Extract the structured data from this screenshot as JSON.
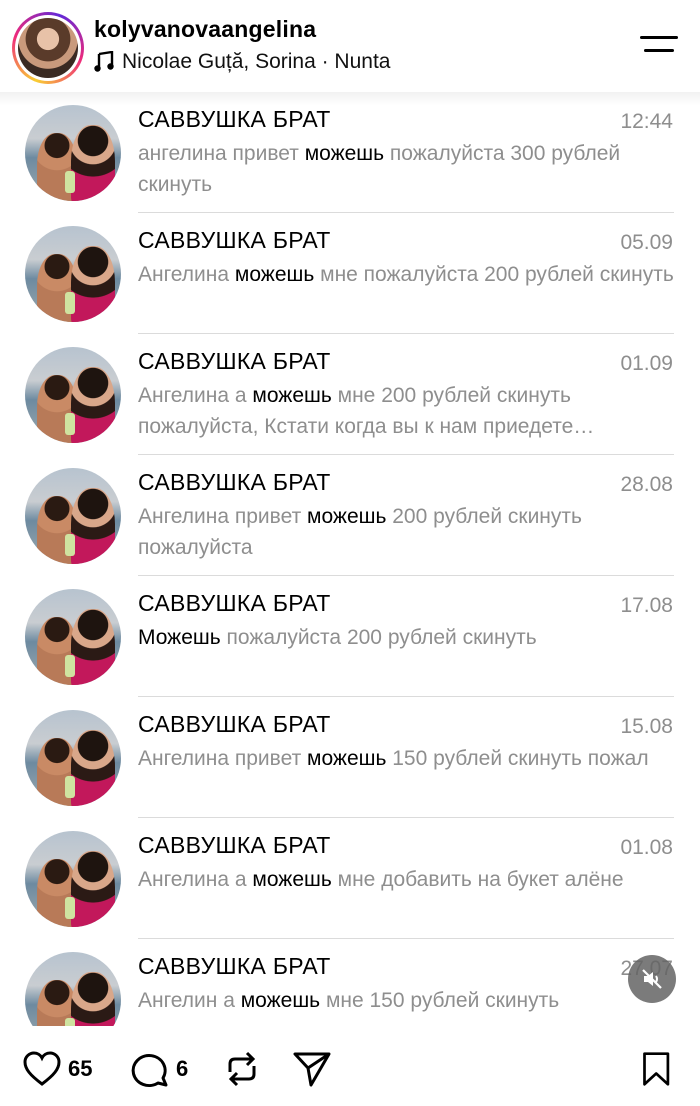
{
  "header": {
    "username": "kolyvanovaangelina",
    "music": "Nicolae Guță, Sorina · Nunta"
  },
  "chats": [
    {
      "name": "САВВУШКА БРАТ",
      "time": "12:44",
      "msg_pre": "ангелина привет ",
      "msg_hl": "можешь",
      "msg_post": " пожалуйста 300 рублей скинуть"
    },
    {
      "name": "САВВУШКА БРАТ",
      "time": "05.09",
      "msg_pre": "Ангелина ",
      "msg_hl": "можешь",
      "msg_post": " мне пожалуйста 200 рублей скинуть"
    },
    {
      "name": "САВВУШКА БРАТ",
      "time": "01.09",
      "msg_pre": "Ангелина а ",
      "msg_hl": "можешь",
      "msg_post": " мне 200 рублей скинуть пожалуйста, Кстати когда вы к нам приедете…"
    },
    {
      "name": "САВВУШКА БРАТ",
      "time": "28.08",
      "msg_pre": "Ангелина привет ",
      "msg_hl": "можешь",
      "msg_post": " 200 рублей скинуть пожалуйста"
    },
    {
      "name": "САВВУШКА БРАТ",
      "time": "17.08",
      "msg_pre": "",
      "msg_hl": "Можешь",
      "msg_post": " пожалуйста 200 рублей скинуть"
    },
    {
      "name": "САВВУШКА БРАТ",
      "time": "15.08",
      "msg_pre": "Ангелина привет ",
      "msg_hl": "можешь",
      "msg_post": " 150 рублей скинуть пожал"
    },
    {
      "name": "САВВУШКА БРАТ",
      "time": "01.08",
      "msg_pre": "Ангелина а ",
      "msg_hl": "можешь",
      "msg_post": " мне добавить на букет алёне"
    },
    {
      "name": "САВВУШКА БРАТ",
      "time": "27.07",
      "msg_pre": "Ангелин а ",
      "msg_hl": "можешь",
      "msg_post": " мне 150 рублей скинуть"
    }
  ],
  "actions": {
    "likes": "65",
    "comments": "6"
  },
  "icons": {
    "music": "music-note-icon",
    "menu": "menu-icon",
    "mute": "muted-speaker-icon",
    "like": "heart-icon",
    "comment": "comment-icon",
    "repost": "repost-icon",
    "share": "paper-plane-icon",
    "save": "bookmark-icon"
  }
}
